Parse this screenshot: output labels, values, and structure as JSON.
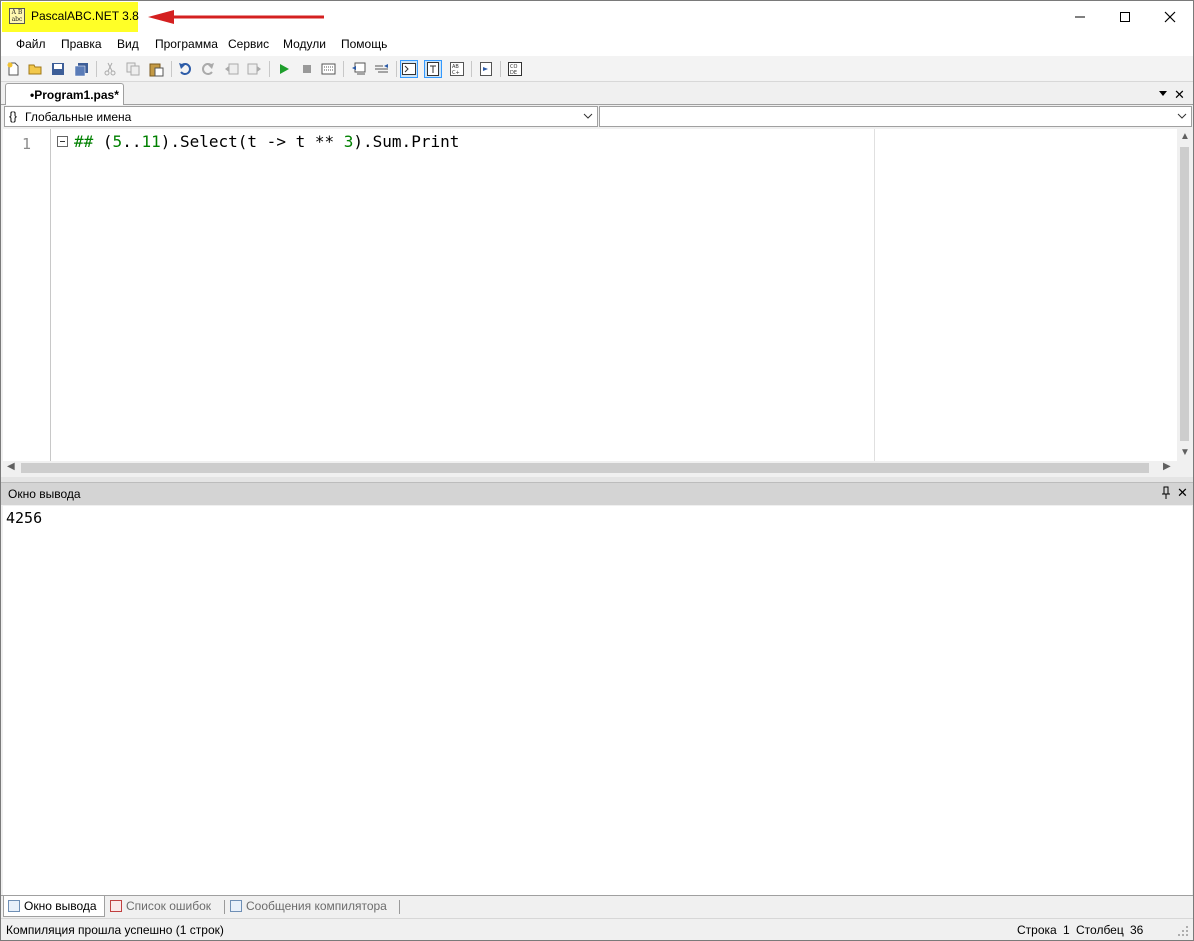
{
  "window": {
    "title": "PascalABC.NET 3.8",
    "icon_text": "A|B\nabc",
    "highlight_color": "#ffff27",
    "arrow_color": "#d42020"
  },
  "menu": [
    "Файл",
    "Правка",
    "Вид",
    "Программа",
    "Сервис",
    "Модули",
    "Помощь"
  ],
  "toolbar": {
    "icons": [
      "new-file-icon",
      "open-file-icon",
      "save-icon",
      "save-all-icon",
      "cut-icon",
      "copy-icon",
      "paste-icon",
      "undo-icon",
      "redo-icon",
      "unindent-icon",
      "indent-icon",
      "run-icon",
      "stop-icon",
      "debug-icon",
      "comment-icon",
      "uncomment-icon",
      "console-icon",
      "text-icon",
      "format-code-icon",
      "navigate-icon",
      "code-templates-icon"
    ]
  },
  "document_tab": {
    "label": "•Program1.pas*"
  },
  "scope_combo": {
    "icon": "{}",
    "value": "Глобальные имена"
  },
  "member_combo": {
    "value": ""
  },
  "editor": {
    "line_number": "1",
    "code": {
      "hash": "## ",
      "open": "(",
      "n1": "5",
      "dots": "..",
      "n2": "11",
      "mid": ").Select(t -> t ** ",
      "n3": "3",
      "tail": ").Sum.Print"
    }
  },
  "output_panel": {
    "title": "Окно вывода",
    "pin": "⭐",
    "text": "4256"
  },
  "bottom_tabs": [
    "Окно вывода",
    "Список ошибок",
    "Сообщения компилятора"
  ],
  "status": {
    "message": "Компиляция прошла успешно (1 строк)",
    "row_label": "Строка",
    "row_value": "1",
    "col_label": "Столбец",
    "col_value": "36"
  }
}
